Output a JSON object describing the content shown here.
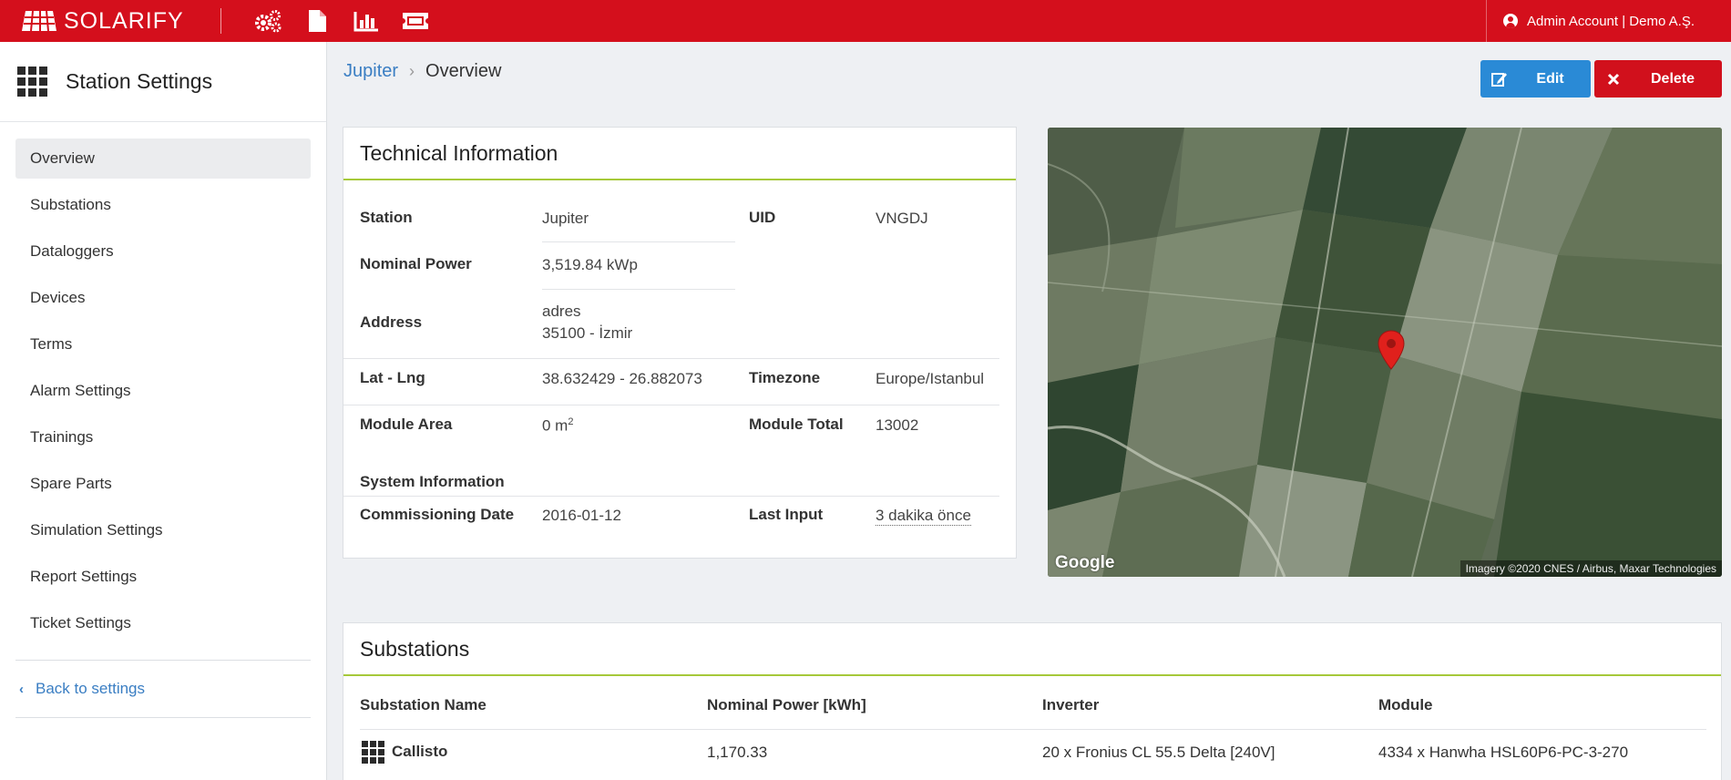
{
  "topbar": {
    "brand": "SOLARIFY",
    "icons": [
      "settings-cogs-icon",
      "document-icon",
      "bar-chart-icon",
      "ticket-icon"
    ],
    "account_label": "Admin Account | Demo A.Ş.",
    "color": "#d40f1c"
  },
  "sidebar": {
    "title": "Station Settings",
    "items": [
      {
        "label": "Overview",
        "active": true
      },
      {
        "label": "Substations"
      },
      {
        "label": "Dataloggers"
      },
      {
        "label": "Devices"
      },
      {
        "label": "Terms"
      },
      {
        "label": "Alarm Settings"
      },
      {
        "label": "Trainings"
      },
      {
        "label": "Spare Parts"
      },
      {
        "label": "Simulation Settings"
      },
      {
        "label": "Report Settings"
      },
      {
        "label": "Ticket Settings"
      }
    ],
    "back_label": "Back to settings"
  },
  "breadcrumb": {
    "parent": "Jupiter",
    "current": "Overview"
  },
  "actions": {
    "edit_label": "Edit",
    "delete_label": "Delete",
    "edit_color": "#2a8ad6",
    "delete_color": "#d1101c"
  },
  "technical": {
    "title": "Technical Information",
    "station_label": "Station",
    "station_value": "Jupiter",
    "uid_label": "UID",
    "uid_value": "VNGDJ",
    "nominal_power_label": "Nominal Power",
    "nominal_power_value": "3,519.84 kWp",
    "address_label": "Address",
    "address_line1": "adres",
    "address_line2": "35100 - İzmir",
    "latlng_label": "Lat - Lng",
    "latlng_value": "38.632429 - 26.882073",
    "timezone_label": "Timezone",
    "timezone_value": "Europe/Istanbul",
    "module_area_label": "Module Area",
    "module_area_value": "0 m",
    "module_area_unit_sup": "2",
    "module_total_label": "Module Total",
    "module_total_value": "13002",
    "system_info_label": "System Information",
    "commissioning_label": "Commissioning Date",
    "commissioning_value": "2016-01-12",
    "last_input_label": "Last Input",
    "last_input_value": "3 dakika önce",
    "accent": "#a6c93a"
  },
  "map": {
    "brand": "Google",
    "credit": "Imagery ©2020 CNES / Airbus, Maxar Technologies",
    "marker": "map-pin-icon"
  },
  "substations": {
    "title": "Substations",
    "columns": [
      "Substation Name",
      "Nominal Power [kWh]",
      "Inverter",
      "Module"
    ],
    "rows": [
      {
        "name": "Callisto",
        "power": "1,170.33",
        "inverter": "20 x Fronius CL 55.5 Delta [240V]",
        "module": "4334 x Hanwha HSL60P6-PC-3-270"
      }
    ]
  }
}
